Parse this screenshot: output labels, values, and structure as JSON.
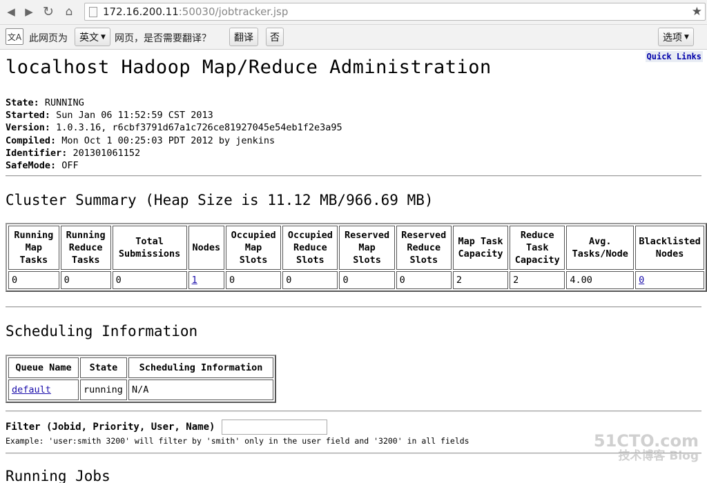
{
  "browser": {
    "url_host": "172.16.200.11",
    "url_rest": ":50030/jobtracker.jsp"
  },
  "translate_bar": {
    "prompt": "此网页为",
    "language": "英文",
    "question": "网页，是否需要翻译？",
    "translate_button": "翻译",
    "no_button": "否",
    "options_button": "选项"
  },
  "page": {
    "quick_links": "Quick Links",
    "title": "localhost Hadoop Map/Reduce Administration",
    "info": [
      {
        "label": "State:",
        "value": "RUNNING"
      },
      {
        "label": "Started:",
        "value": "Sun Jan 06 11:52:59 CST 2013"
      },
      {
        "label": "Version:",
        "value": "1.0.3.16, r6cbf3791d67a1c726ce81927045e54eb1f2e3a95"
      },
      {
        "label": "Compiled:",
        "value": "Mon Oct 1 00:25:03 PDT 2012 by jenkins"
      },
      {
        "label": "Identifier:",
        "value": "201301061152"
      },
      {
        "label": "SafeMode:",
        "value": "OFF"
      }
    ],
    "cluster_summary_title": "Cluster Summary (Heap Size is 11.12 MB/966.69 MB)",
    "cluster_table": {
      "headers": [
        "Running\nMap\nTasks",
        "Running\nReduce\nTasks",
        "Total\nSubmissions",
        "Nodes",
        "Occupied\nMap\nSlots",
        "Occupied\nReduce\nSlots",
        "Reserved\nMap\nSlots",
        "Reserved\nReduce\nSlots",
        "Map Task\nCapacity",
        "Reduce\nTask\nCapacity",
        "Avg.\nTasks/Node",
        "Blacklisted\nNodes"
      ],
      "values": [
        "0",
        "0",
        "0",
        "1",
        "0",
        "0",
        "0",
        "0",
        "2",
        "2",
        "4.00",
        "0"
      ]
    },
    "scheduling_title": "Scheduling Information",
    "scheduling_table": {
      "headers": [
        "Queue Name",
        "State",
        "Scheduling Information"
      ],
      "row": [
        "default",
        "running",
        "N/A"
      ]
    },
    "filter_label": "Filter (Jobid, Priority, User, Name)",
    "filter_value": "",
    "example_text": "Example: 'user:smith 3200' will filter by 'smith' only in the user field and '3200' in all fields",
    "running_jobs_title": "Running Jobs",
    "watermark_line1": "51CTO.com",
    "watermark_line2": "技术博客 Blog"
  }
}
